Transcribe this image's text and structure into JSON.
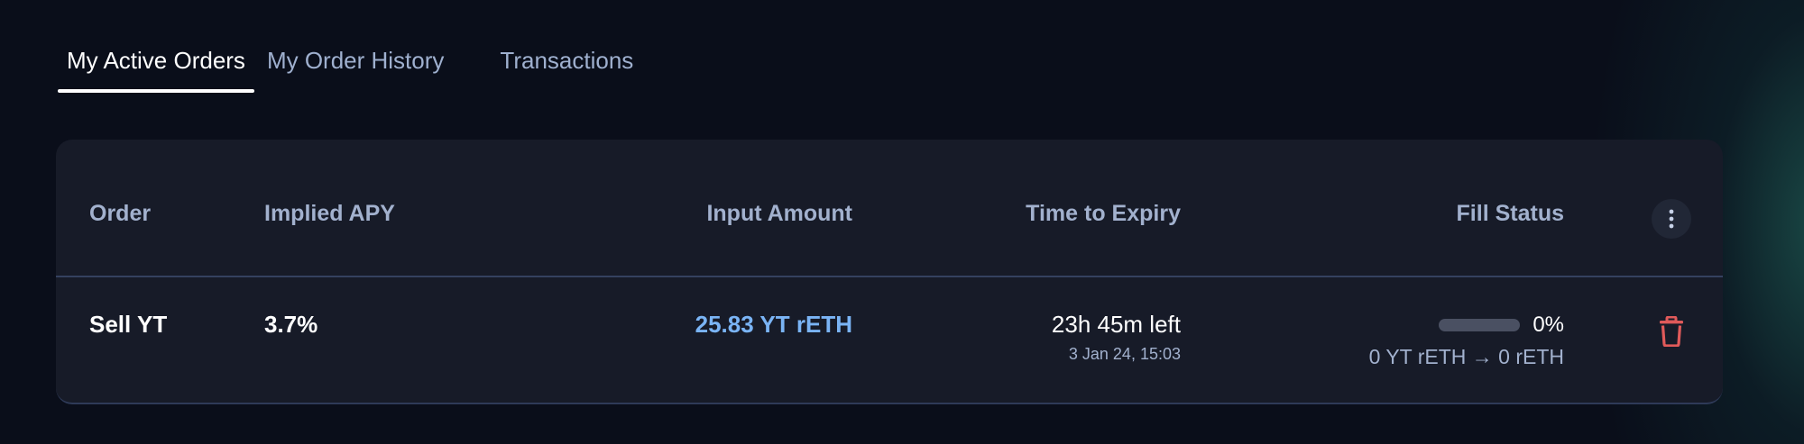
{
  "tabs": [
    {
      "label": "My Active Orders",
      "active": true
    },
    {
      "label": "My Order History",
      "active": false
    },
    {
      "label": "Transactions",
      "active": false
    }
  ],
  "table": {
    "columns": [
      "Order",
      "Implied APY",
      "Input Amount",
      "Time to Expiry",
      "Fill Status"
    ],
    "menu_icon": "more-vertical-icon",
    "rows": [
      {
        "order": "Sell YT",
        "implied_apy": "3.7%",
        "input_amount": "25.83 YT rETH",
        "time_left": "23h 45m left",
        "expiry_date": "3 Jan 24, 15:03",
        "fill_percent": "0%",
        "fill_fraction": 0,
        "fill_detail": "0 YT rETH → 0 rETH",
        "delete_icon": "trash-icon"
      }
    ]
  },
  "colors": {
    "background": "#0a0e1a",
    "card": "#171b28",
    "accent_blue": "#7ab4f5",
    "muted_text": "#a2b1ce",
    "delete_red": "#e05a5a",
    "glow_teal": "#267869"
  }
}
